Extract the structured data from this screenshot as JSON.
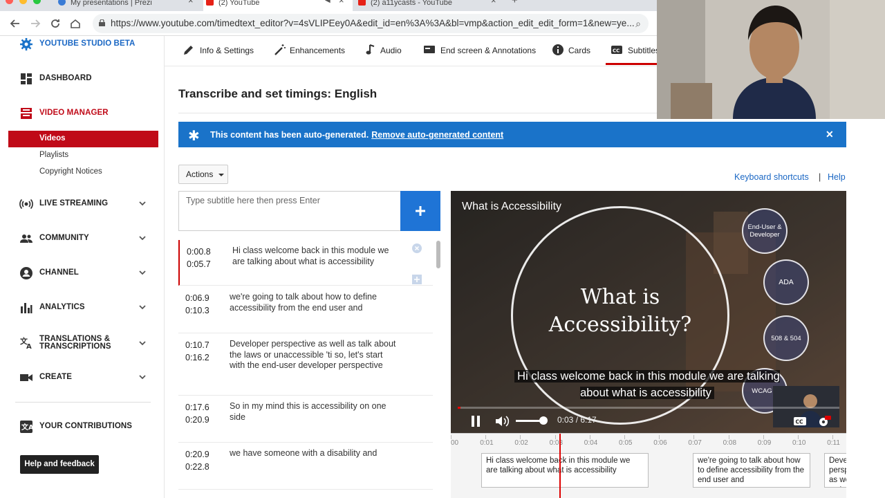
{
  "browser": {
    "tabs": [
      {
        "label": "My presentations | Prezi"
      },
      {
        "label": "(2) YouTube"
      },
      {
        "label": "(2) a11ycasts - YouTube"
      }
    ],
    "url": "https://www.youtube.com/timedtext_editor?v=4sVLIPEey0A&edit_id=en%3A%3A&bl=vmp&action_edit_edit_form=1&new=ye..."
  },
  "sidebar": {
    "brand": "YOUTUBE STUDIO BETA",
    "dashboard": "DASHBOARD",
    "video_manager": "VIDEO MANAGER",
    "sub_items": [
      "Videos",
      "Playlists",
      "Copyright Notices"
    ],
    "live_streaming": "LIVE STREAMING",
    "community": "COMMUNITY",
    "channel": "CHANNEL",
    "analytics": "ANALYTICS",
    "translations_1": "TRANSLATIONS &",
    "translations_2": "TRANSCRIPTIONS",
    "create": "CREATE",
    "contributions": "YOUR CONTRIBUTIONS",
    "help_feedback": "Help and feedback"
  },
  "tabs": [
    "Info & Settings",
    "Enhancements",
    "Audio",
    "End screen & Annotations",
    "Cards",
    "Subtitles"
  ],
  "page_title": "Transcribe and set timings: English",
  "banner": {
    "message": "This content has been auto-generated.",
    "link": "Remove auto-generated content"
  },
  "actions_label": "Actions",
  "keyboard_shortcuts": "Keyboard shortcuts",
  "separator": "|",
  "help": "Help",
  "subtitle_input": {
    "placeholder": "Type subtitle here then press Enter"
  },
  "captions": [
    {
      "start": "0:00.8",
      "end": "0:05.7",
      "text": "Hi class welcome back in this module we are talking about what is accessibility"
    },
    {
      "start": "0:06.9",
      "end": "0:10.3",
      "text": "we're going to talk about how to define accessibility from the end user and"
    },
    {
      "start": "0:10.7",
      "end": "0:16.2",
      "text": "Developer perspective as well as talk about the laws or unaccessible 'ti so, let's start with the end-user developer perspective"
    },
    {
      "start": "0:17.6",
      "end": "0:20.9",
      "text": "So in my mind this is accessibility on one side"
    },
    {
      "start": "0:20.9",
      "end": "0:22.8",
      "text": "we have someone with a disability and"
    }
  ],
  "video": {
    "title": "What is Accessibility",
    "slide_title_1": "What is",
    "slide_title_2": "Accessibility?",
    "circles": [
      "End-User & Developer",
      "ADA",
      "508 & 504",
      "WCAG 2"
    ],
    "caption": "Hi class welcome back in this module we are talking about what is accessibility",
    "time": "0:03 / 6:17",
    "progress": 0.008,
    "volume": 0.9
  },
  "timeline": {
    "ticks": [
      "00",
      "0:01",
      "0:02",
      "0:03",
      "0:04",
      "0:05",
      "0:06",
      "0:07",
      "0:08",
      "0:09",
      "0:10",
      "0:11"
    ],
    "captions": [
      "Hi class welcome back in this module we are talking about what is accessibility",
      "we're going to talk about how to define accessibility from the end user and",
      "Developer perspective as well as talk about the laws or unaccessible"
    ]
  },
  "colors": {
    "accent_red": "#c00a18",
    "banner_blue": "#1a73c9",
    "add_blue": "#1f74d6",
    "link_blue": "#1a67c4"
  }
}
